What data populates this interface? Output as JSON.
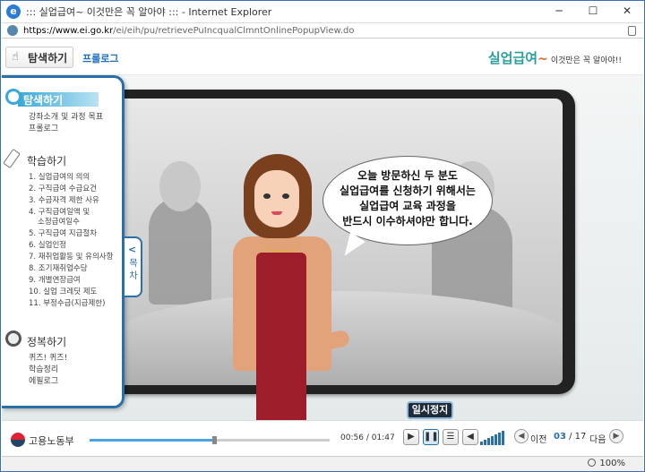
{
  "window": {
    "title": "::: 실업급여~ 이것만은 꼭 알아야 ::: - Internet Explorer",
    "minimize": "─",
    "maximize": "☐",
    "close": "✕"
  },
  "address": {
    "host": "https://www.ei.go.kr",
    "path": "/ei/eih/pu/retrievePuIncqualClmntOnlinePopupView.do"
  },
  "header": {
    "explore_tab": "탐색하기",
    "prologue_link": "프롤로그",
    "brand_main": "실업급여",
    "brand_tilde": "~",
    "brand_sub": "이것만은 꼭 알아야!!"
  },
  "sidebar": {
    "explore": {
      "title": "탐색하기",
      "items": [
        "강좌소개 및 과정 목표",
        "프롤로그"
      ]
    },
    "learn": {
      "title": "학습하기",
      "items": [
        "1. 실업급여의 의의",
        "2. 구직급여 수급요건",
        "3. 수급자격 제한 사유",
        "4. 구직급여일액 및",
        "소정급여일수",
        "5. 구직급여 지급절차",
        "6. 실업인정",
        "7. 재취업활동 및 유의사항",
        "8. 조기재취업수당",
        "9. 개별연장급여",
        "10. 실업 크레딧 제도",
        "11. 부정수급(지급제한)"
      ]
    },
    "conquer": {
      "title": "정복하기",
      "items": [
        "퀴즈! 퀴즈!",
        "학습정리",
        "에필로그"
      ]
    },
    "toc_label": "목차",
    "toc_chevron": "<"
  },
  "stage": {
    "speech_lines": [
      "오늘 방문하신 두 분도",
      "실업급여를 신청하기 위해서는",
      "실업급여 교육 과정을",
      "반드시 이수하셔야만 합니다."
    ]
  },
  "controls": {
    "org_name": "고용노동부",
    "time_current": "00:56",
    "time_separator": "/",
    "time_total": "01:47",
    "progress_fraction": 0.52,
    "tooltip": "일시정지",
    "play_icon": "▶",
    "pause_icon": "❚❚",
    "menu_icon": "☰",
    "volume_icon": "◀",
    "prev_label": "이전",
    "next_label": "다음",
    "page_current": "03",
    "page_separator": "/",
    "page_total": "17",
    "volume_level_bars": 7
  },
  "statusbar": {
    "zoom": "100%"
  }
}
